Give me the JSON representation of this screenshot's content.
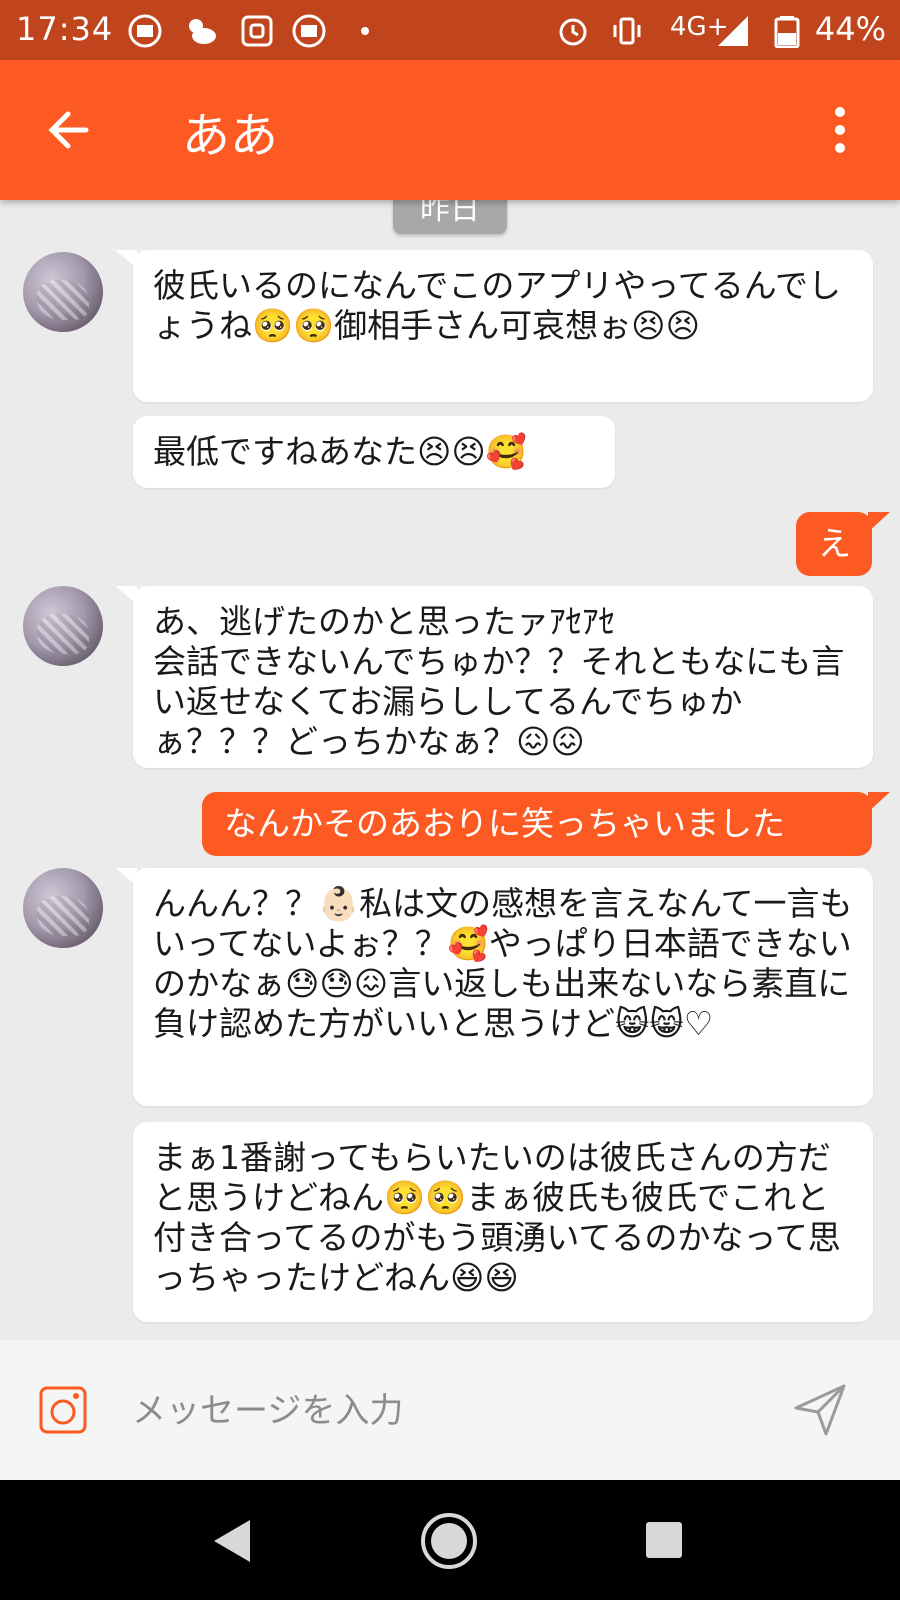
{
  "status_bar": {
    "time": "17:34",
    "network": "4G+",
    "battery": "44%"
  },
  "header": {
    "title": "ああ"
  },
  "chat": {
    "date_chip": "昨日",
    "messages": [
      {
        "dir": "in",
        "text": "彼氏いるのになんでこのアプリやってるんでしょうね🥺🥺御相手さん可哀想ぉ😣😣"
      },
      {
        "dir": "in",
        "text": "最低ですねあなた😣😣🥰"
      },
      {
        "dir": "out",
        "text": "え"
      },
      {
        "dir": "in",
        "text": "あ、逃げたのかと思ったァｱｾｱｾ\n会話できないんでちゅか？？それともなにも言い返せなくてお漏らししてるんでちゅかぁ？？？どっちかなぁ？😖😖"
      },
      {
        "dir": "out",
        "text": "なんかそのあおりに笑っちゃいました"
      },
      {
        "dir": "in",
        "text": "んんん？？👶🏻私は文の感想を言えなんて一言もいってないよぉ？？🥰やっぱり日本語できないのかなぁ😓😓😖言い返しも出来ないなら素直に負け認めた方がいいと思うけど😸😸♡"
      },
      {
        "dir": "in",
        "text": "まぁ1番謝ってもらいたいのは彼氏さんの方だと思うけどねん🥺🥺まぁ彼氏も彼氏でこれと付き合ってるのがもう頭湧いてるのかなって思っちゃったけどねん😆😆"
      }
    ]
  },
  "composer": {
    "placeholder": "メッセージを入力"
  },
  "colors": {
    "accent": "#fc5a22",
    "status_bar": "#c0441c",
    "background": "#ebebeb"
  },
  "icons": [
    "alarm-icon",
    "vibrate-icon",
    "signal-icon",
    "battery-icon",
    "back-arrow-icon",
    "more-vert-icon",
    "instagram-icon",
    "send-icon",
    "nav-back-icon",
    "nav-home-icon",
    "nav-recent-icon"
  ]
}
